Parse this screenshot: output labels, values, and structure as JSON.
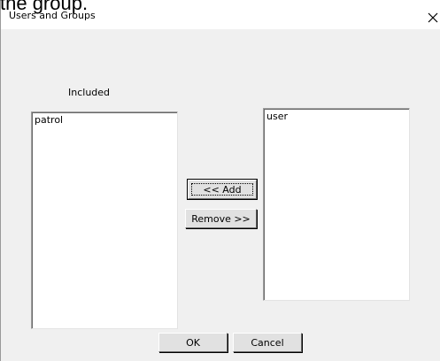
{
  "caption": "the group.",
  "dialog": {
    "title": "Users and Groups",
    "close_glyph": "✕"
  },
  "included": {
    "label": "Included",
    "items": [
      "patrol"
    ]
  },
  "available": {
    "items": [
      "user"
    ]
  },
  "buttons": {
    "add": "<< Add",
    "remove": "Remove >>",
    "ok": "OK",
    "cancel": "Cancel"
  }
}
